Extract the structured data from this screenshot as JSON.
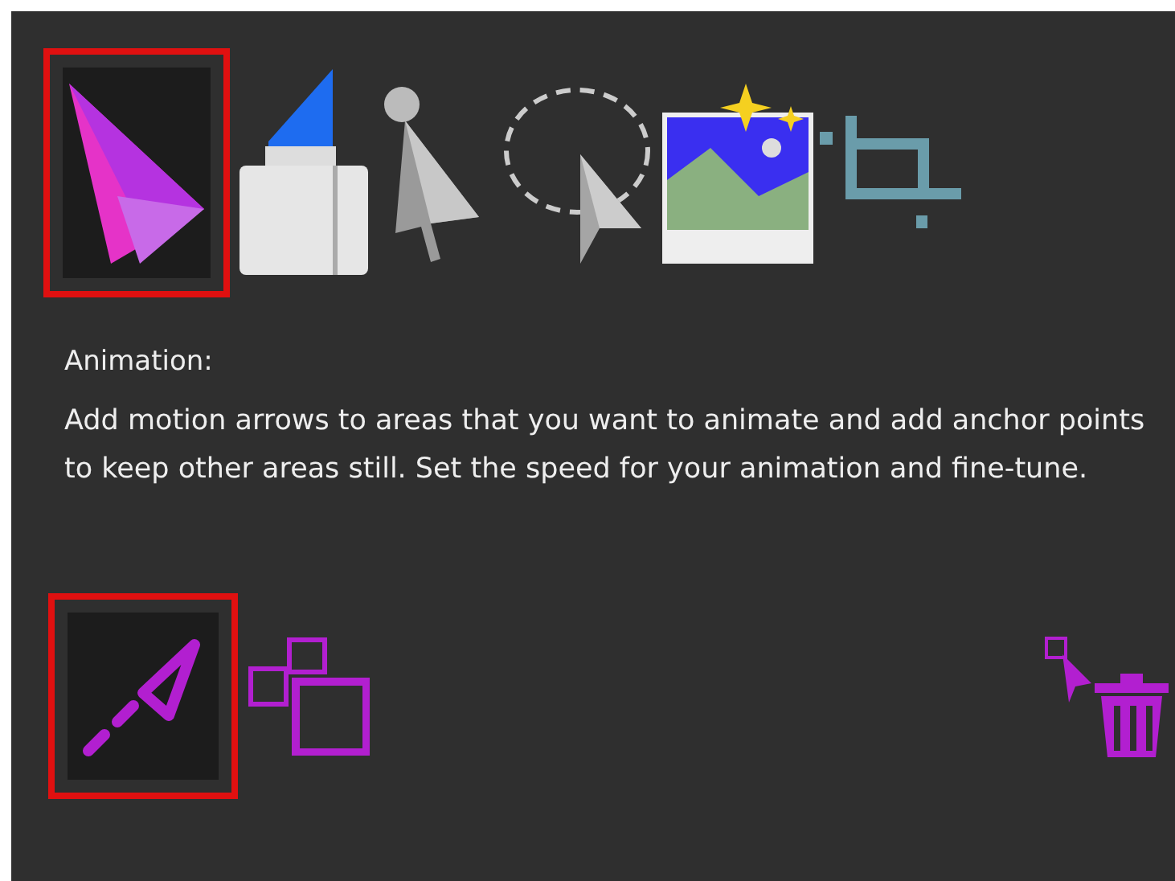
{
  "tools": [
    {
      "kind": "animation",
      "selected": true
    },
    {
      "kind": "marker",
      "selected": false
    },
    {
      "kind": "anchor",
      "selected": false
    },
    {
      "kind": "lasso",
      "selected": false
    },
    {
      "kind": "image",
      "selected": false
    },
    {
      "kind": "crop",
      "selected": false
    }
  ],
  "description": {
    "title": "Animation:",
    "body": "Add motion arrows to areas that you want to animate and add anchor points to keep other areas still. Set the speed for your animation and fine-tune."
  },
  "bottom_tools": [
    {
      "kind": "arrow",
      "selected": true
    },
    {
      "kind": "squares",
      "selected": false
    },
    {
      "kind": "delete",
      "selected": false
    }
  ]
}
